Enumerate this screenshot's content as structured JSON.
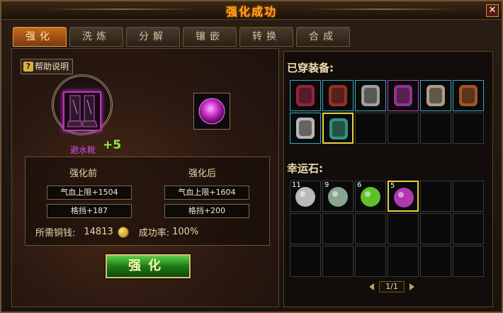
{
  "window": {
    "title": "强化成功",
    "close_label": "✕"
  },
  "tabs": [
    {
      "label": "强化",
      "active": true
    },
    {
      "label": "洗炼",
      "active": false
    },
    {
      "label": "分解",
      "active": false
    },
    {
      "label": "镶嵌",
      "active": false
    },
    {
      "label": "转换",
      "active": false
    },
    {
      "label": "合成",
      "active": false
    }
  ],
  "help": {
    "icon_glyph": "?",
    "label": "帮助说明"
  },
  "equipment": {
    "name": "避水靴",
    "level": "+5",
    "icon": "boots-icon"
  },
  "stats": {
    "before_title": "强化前",
    "after_title": "强化后",
    "before": {
      "hp": "气血上限+1504",
      "block": "格挡+187"
    },
    "after": {
      "hp": "气血上限+1604",
      "block": "格挡+200"
    }
  },
  "cost": {
    "label": "所需铜钱:",
    "value": "14813",
    "rate_label": "成功率:",
    "rate": "100%"
  },
  "enhance_button": "强化",
  "equipped": {
    "header": "已穿装备:",
    "items": [
      {
        "icon": "amulet-icon",
        "color": "#c03050"
      },
      {
        "icon": "armor-icon",
        "color": "#c04030"
      },
      {
        "icon": "robe-icon",
        "color": "#d0d0d0"
      },
      {
        "icon": "boots-icon",
        "color": "#c040c0"
      },
      {
        "icon": "necklace-icon",
        "color": "#e0d0b0"
      },
      {
        "icon": "mask-icon",
        "color": "#d07030"
      },
      {
        "icon": "bracelet-icon",
        "color": "#f0f0f0"
      },
      {
        "icon": "ring-icon",
        "color": "#40c0a0"
      }
    ]
  },
  "lucky_stones": {
    "header": "幸运石:",
    "items": [
      {
        "count": "11",
        "color": "#d8d8d8"
      },
      {
        "count": "9",
        "color": "#a0c0a8"
      },
      {
        "count": "6",
        "color": "#70e030"
      },
      {
        "count": "5",
        "color": "#d040d0"
      }
    ]
  },
  "pager": {
    "text": "1/1"
  },
  "colors": {
    "accent_gold": "#f5a623",
    "tab_active": "#c96a1c",
    "purple_quality": "#d050e0",
    "level_green": "#8ef040",
    "button_green": "#1d7a18"
  }
}
